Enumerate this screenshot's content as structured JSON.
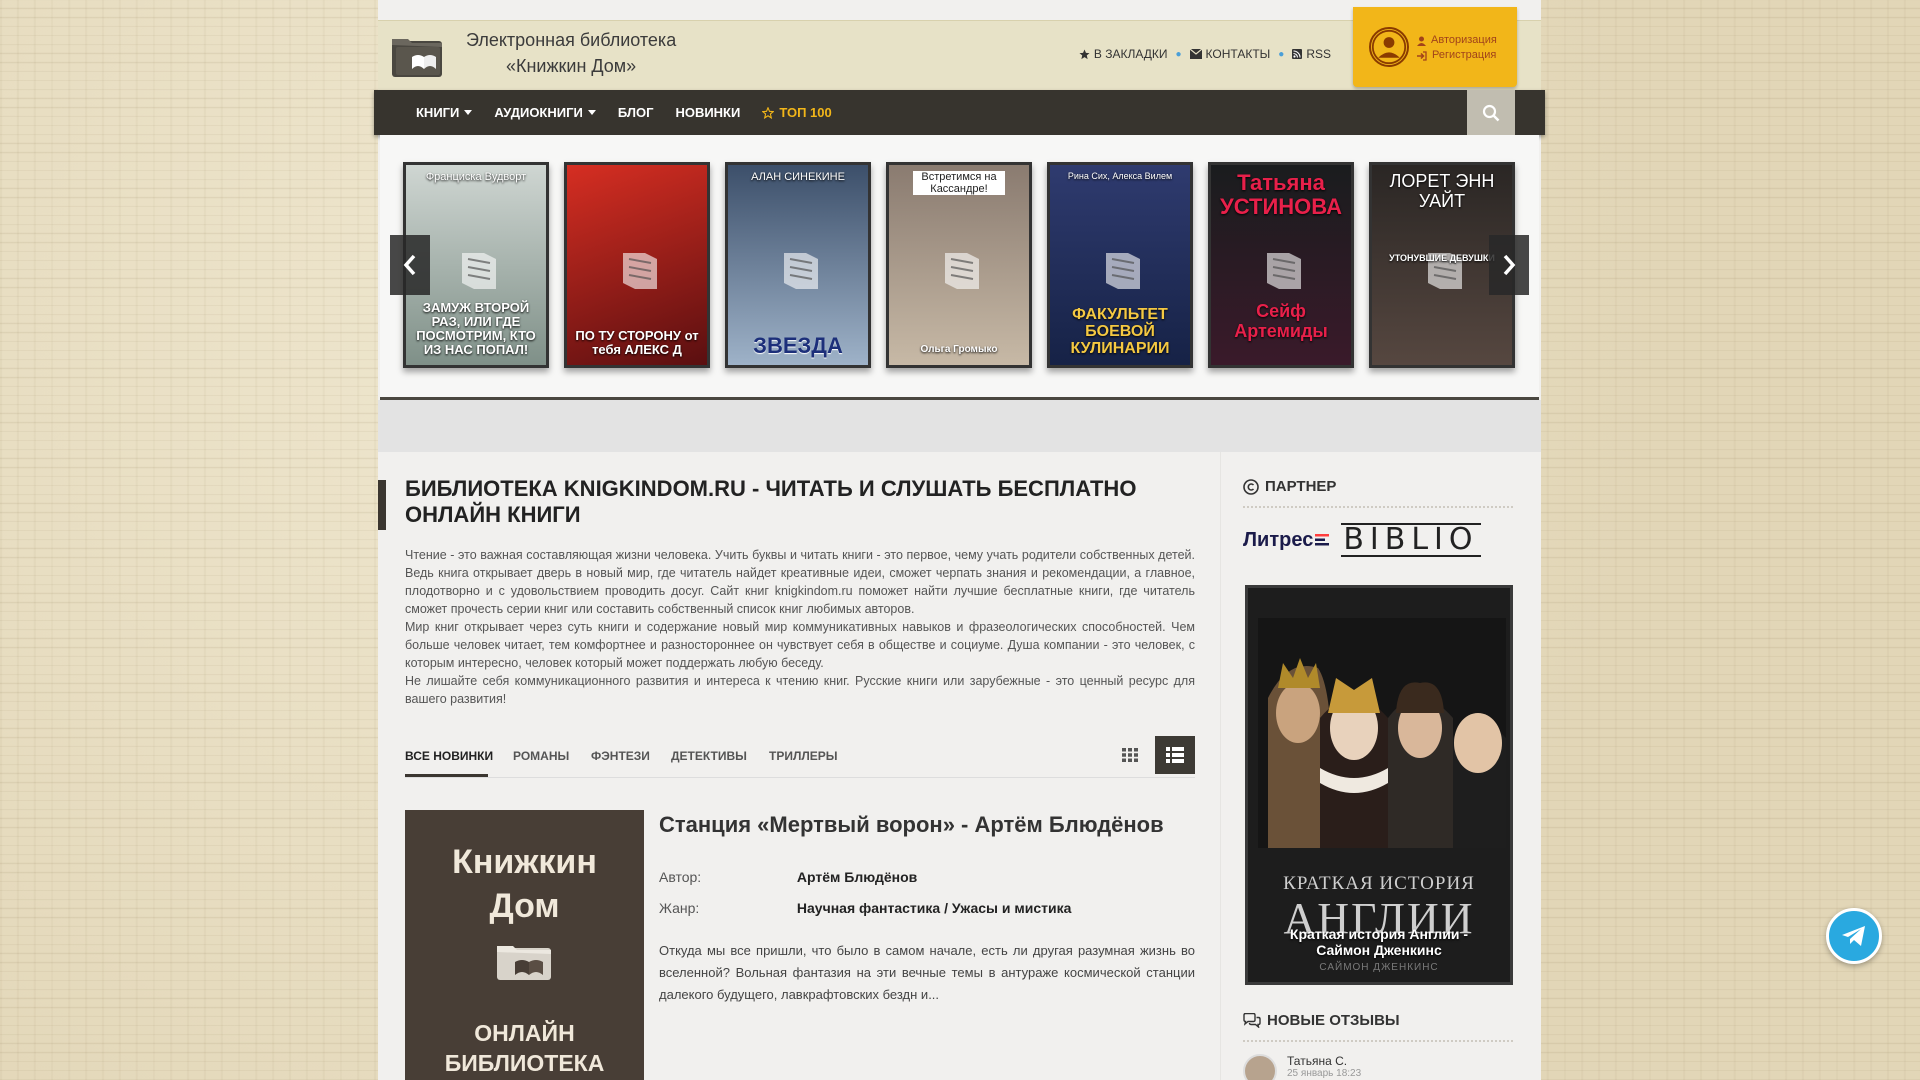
{
  "header": {
    "title_line1": "Электронная библиотека",
    "title_line2": "«Книжкин Дом»",
    "links": [
      {
        "label": "В ЗАКЛАДКИ",
        "icon": "star-icon"
      },
      {
        "label": "КОНТАКТЫ",
        "icon": "envelope-icon"
      },
      {
        "label": "RSS",
        "icon": "rss-icon"
      }
    ],
    "auth": {
      "login": "Авторизация",
      "register": "Регистрация"
    }
  },
  "nav": {
    "items": [
      {
        "label": "КНИГИ",
        "dropdown": true
      },
      {
        "label": "АУДИОКНИГИ",
        "dropdown": true
      },
      {
        "label": "БЛОГ",
        "dropdown": false
      },
      {
        "label": "НОВИНКИ",
        "dropdown": false
      },
      {
        "label": "ТОП 100",
        "dropdown": false
      }
    ]
  },
  "carousel": {
    "books": [
      {
        "author": "Франциска Вудворт",
        "title": "ЗАМУЖ ВТОРОЙ РАЗ, ИЛИ ГДЕ ПОСМОТРИМ, КТО ИЗ НАС ПОПАЛ!",
        "color1": "#cfd6d2",
        "color2": "#7f9088"
      },
      {
        "author": "",
        "title": "ПО ТУ СТОРОНУ от тебя АЛЕКС Д",
        "color1": "#d62e22",
        "color2": "#5a0f10"
      },
      {
        "author": "АЛАН СИНЕКИНЕ",
        "title": "ЗВЕЗДА",
        "color1": "#3c4f6a",
        "color2": "#9eb2c8"
      },
      {
        "author": "Встретимся на Кассандре!",
        "title": "Ольга Громыко",
        "color1": "#8a7b70",
        "color2": "#c7b9a6"
      },
      {
        "author": "Рина Сих, Алекса Вилем",
        "title": "ФАКУЛЬТЕТ БОЕВОЙ КУЛИНАРИИ",
        "color1": "#2f3b6f",
        "color2": "#162246"
      },
      {
        "author": "Татьяна УСТИНОВА",
        "title": "Сейф Артемиды",
        "color1": "#1a1c1e",
        "color2": "#3a1a2a"
      },
      {
        "author": "ЛОРЕТ ЭНН УАЙТ",
        "title": "УТОНУВШИЕ ДЕВУШКИ",
        "color1": "#2a2624",
        "color2": "#564740"
      }
    ]
  },
  "main": {
    "title": "БИБЛИОТЕКА KNIGKINDOM.RU - ЧИТАТЬ И СЛУШАТЬ БЕСПЛАТНО ОНЛАЙН КНИГИ",
    "intro_p1": "Чтение - это важная составляющая жизни человека. Учить буквы и читать книги - это первое, чему учать родители собственных детей. Ведь книга открывает дверь в новый мир, где читатель найдет креативные идеи, сможет черпать знания и рекомендации, а главное, плодотворно и с удовольствием проводить досуг. Сайт книг knigkindom.ru поможет найти лучшие бесплатные книги, где читатель сможет прочесть серии книг или составить собственный список книг любимых авторов.",
    "intro_p2": "Мир книг открывает через суть книги и содержание новый мир коммуникативных навыков и фразеологических способностей. Чем больше человек читает, тем комфортнее и разностороннее он чувствует себя в обществе и социуме. Душа компании - это человек, с которым интересно, человек который может поддержать любую беседу.",
    "intro_p3": "Не лишайте себя коммуникационного развития и интереса к чтению книг. Русские книги или зарубежные - это ценный ресурс для вашего развития!",
    "tabs": [
      "ВСЕ НОВИНКИ",
      "РОМАНЫ",
      "ФЭНТЕЗИ",
      "ДЕТЕКТИВЫ",
      "ТРИЛЛЕРЫ"
    ],
    "book": {
      "cover_brand_l1": "Книжкин",
      "cover_brand_l2": "Дом",
      "cover_sub_l1": "ОНЛАЙН",
      "cover_sub_l2": "БИБЛИОТЕКА",
      "title": "Станция «Мертвый ворон» - Артём Блюдёнов",
      "author_label": "Автор:",
      "author": "Артём Блюдёнов",
      "genre_label": "Жанр:",
      "genre": "Научная фантастика / Ужасы и мистика",
      "description": "Откуда мы все пришли, что было в самом начале, есть ли другая разумная жизнь во вселенной? Вольная фантазия на эти вечные темы в антураже космической станции далекого будущего, лавкрафтовских бездн и..."
    }
  },
  "sidebar": {
    "partner_title": "ПАРТНЕР",
    "litres": "Литрес",
    "biblio": "BIBLIO",
    "promo": {
      "big_l1": "КРАТКАЯ ИСТОРИЯ",
      "big_l2": "АНГЛИИ",
      "caption_l1": "Краткая история Англии -",
      "caption_l2": "Саймон Дженкинс",
      "author_small": "САЙМОН ДЖЕНКИНС"
    },
    "reviews_title": "НОВЫЕ ОТЗЫВЫ",
    "reviewer_name": "Татьяна С.",
    "reviewer_date": "25 январь 18:23"
  },
  "colors": {
    "accent": "#f2b619",
    "nav_bg": "#37342e",
    "telegram": "#29a9e0"
  }
}
